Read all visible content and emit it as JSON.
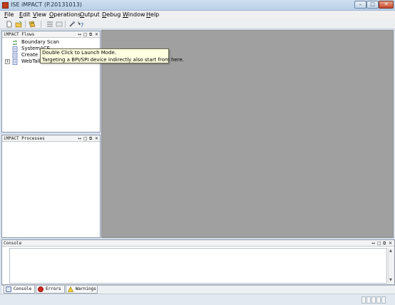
{
  "window": {
    "title": "ISE iMPACT (P.20131013)"
  },
  "menu": {
    "items": [
      {
        "label": "File"
      },
      {
        "label": "Edit"
      },
      {
        "label": "View"
      },
      {
        "label": "Operations"
      },
      {
        "label": "Output"
      },
      {
        "label": "Debug"
      },
      {
        "label": "Window"
      },
      {
        "label": "Help"
      }
    ]
  },
  "flows": {
    "title": "iMPACT Flows",
    "items": [
      {
        "label": "Boundary Scan",
        "icon": "boundary-scan-icon"
      },
      {
        "label": "SystemACE",
        "icon": "document-icon"
      },
      {
        "label": "Create PROM File (PROM File Formatter)",
        "icon": "document-icon"
      },
      {
        "label": "WebTalk Data",
        "icon": "document-icon"
      }
    ]
  },
  "tooltip": {
    "line1": "Double Click to Launch Mode.",
    "line2": "Targeting a BPI/SPI device indirectly also start from here."
  },
  "processes": {
    "title": "iMPACT Processes"
  },
  "console": {
    "title": "Console"
  },
  "tabs": [
    {
      "label": "Console",
      "icon": "console-icon"
    },
    {
      "label": "Errors",
      "icon": "error-icon"
    },
    {
      "label": "Warnings",
      "icon": "warning-icon"
    }
  ],
  "panel_controls": {
    "pin": "↔",
    "restore": "□",
    "float": "⧉",
    "close": "✕"
  }
}
